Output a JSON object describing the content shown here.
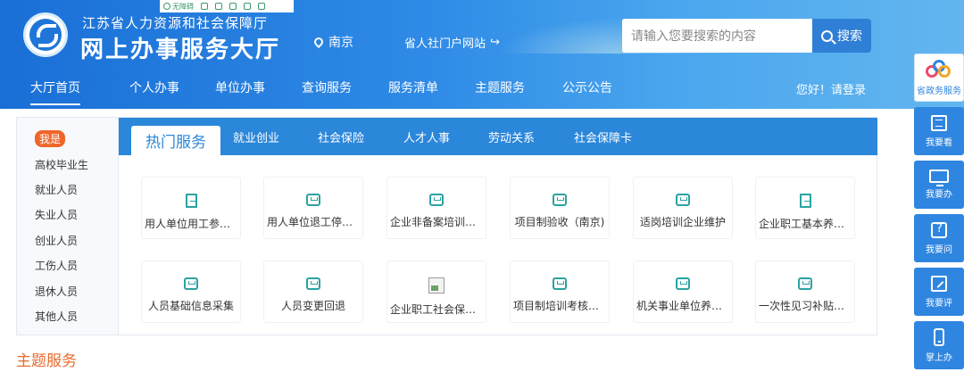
{
  "header": {
    "org_name": "江苏省人力资源和社会保障厅",
    "hall_name": "网上办事服务大厅",
    "location": "南京",
    "portal_link": "省人社门户网站",
    "toolbar": {
      "accessibility": "无障碍"
    },
    "search": {
      "placeholder": "请输入您要搜索的内容",
      "button": "搜索"
    },
    "nav": [
      "大厅首页",
      "个人办事",
      "单位办事",
      "查询服务",
      "服务清单",
      "主题服务",
      "公示公告"
    ],
    "active_nav": "大厅首页",
    "login_text": "您好！请登录"
  },
  "sidebar": {
    "me_badge": "我是",
    "items": [
      "高校毕业生",
      "就业人员",
      "失业人员",
      "创业人员",
      "工伤人员",
      "退休人员",
      "其他人员"
    ]
  },
  "tabs": [
    "热门服务",
    "就业创业",
    "社会保险",
    "人才人事",
    "劳动关系",
    "社会保障卡"
  ],
  "services": [
    {
      "label": "用人单位用工参保…",
      "icon": "document-icon"
    },
    {
      "label": "用人单位退工停保…",
      "icon": "inbox-icon"
    },
    {
      "label": "企业非备案培训补…",
      "icon": "inbox-icon"
    },
    {
      "label": "项目制验收（南京)",
      "icon": "inbox-icon"
    },
    {
      "label": "适岗培训企业维护",
      "icon": "inbox-icon"
    },
    {
      "label": "企业职工基本养老…",
      "icon": "document-icon"
    },
    {
      "label": "人员基础信息采集",
      "icon": "inbox-icon"
    },
    {
      "label": "人员变更回退",
      "icon": "inbox-icon"
    },
    {
      "label": "企业职工社会保险…",
      "icon": "broken-image-icon"
    },
    {
      "label": "项目制培训考核信…",
      "icon": "inbox-icon"
    },
    {
      "label": "机关事业单位养老…",
      "icon": "inbox-icon"
    },
    {
      "label": "一次性见习补贴申…",
      "icon": "inbox-icon"
    }
  ],
  "section_title": "主题服务",
  "float_bar": [
    "省政务服务",
    "我要看",
    "我要办",
    "我要问",
    "我要评",
    "掌上办"
  ],
  "colors": {
    "primary": "#2b87da",
    "accent": "#f0652c",
    "teal_icon": "#2aa3a1"
  }
}
